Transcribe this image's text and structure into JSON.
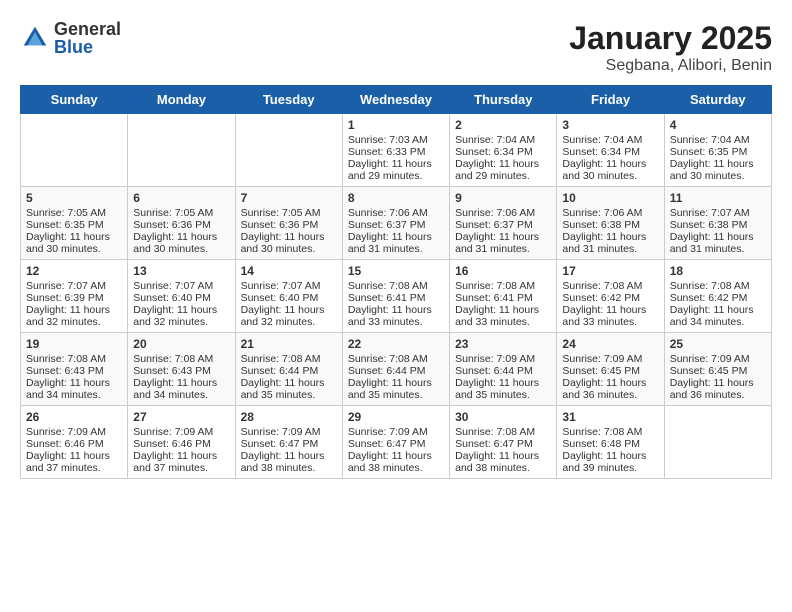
{
  "header": {
    "logo_general": "General",
    "logo_blue": "Blue",
    "title": "January 2025",
    "subtitle": "Segbana, Alibori, Benin"
  },
  "days_of_week": [
    "Sunday",
    "Monday",
    "Tuesday",
    "Wednesday",
    "Thursday",
    "Friday",
    "Saturday"
  ],
  "weeks": [
    [
      {
        "day": "",
        "sunrise": "",
        "sunset": "",
        "daylight": ""
      },
      {
        "day": "",
        "sunrise": "",
        "sunset": "",
        "daylight": ""
      },
      {
        "day": "",
        "sunrise": "",
        "sunset": "",
        "daylight": ""
      },
      {
        "day": "1",
        "sunrise": "Sunrise: 7:03 AM",
        "sunset": "Sunset: 6:33 PM",
        "daylight": "Daylight: 11 hours and 29 minutes."
      },
      {
        "day": "2",
        "sunrise": "Sunrise: 7:04 AM",
        "sunset": "Sunset: 6:34 PM",
        "daylight": "Daylight: 11 hours and 29 minutes."
      },
      {
        "day": "3",
        "sunrise": "Sunrise: 7:04 AM",
        "sunset": "Sunset: 6:34 PM",
        "daylight": "Daylight: 11 hours and 30 minutes."
      },
      {
        "day": "4",
        "sunrise": "Sunrise: 7:04 AM",
        "sunset": "Sunset: 6:35 PM",
        "daylight": "Daylight: 11 hours and 30 minutes."
      }
    ],
    [
      {
        "day": "5",
        "sunrise": "Sunrise: 7:05 AM",
        "sunset": "Sunset: 6:35 PM",
        "daylight": "Daylight: 11 hours and 30 minutes."
      },
      {
        "day": "6",
        "sunrise": "Sunrise: 7:05 AM",
        "sunset": "Sunset: 6:36 PM",
        "daylight": "Daylight: 11 hours and 30 minutes."
      },
      {
        "day": "7",
        "sunrise": "Sunrise: 7:05 AM",
        "sunset": "Sunset: 6:36 PM",
        "daylight": "Daylight: 11 hours and 30 minutes."
      },
      {
        "day": "8",
        "sunrise": "Sunrise: 7:06 AM",
        "sunset": "Sunset: 6:37 PM",
        "daylight": "Daylight: 11 hours and 31 minutes."
      },
      {
        "day": "9",
        "sunrise": "Sunrise: 7:06 AM",
        "sunset": "Sunset: 6:37 PM",
        "daylight": "Daylight: 11 hours and 31 minutes."
      },
      {
        "day": "10",
        "sunrise": "Sunrise: 7:06 AM",
        "sunset": "Sunset: 6:38 PM",
        "daylight": "Daylight: 11 hours and 31 minutes."
      },
      {
        "day": "11",
        "sunrise": "Sunrise: 7:07 AM",
        "sunset": "Sunset: 6:38 PM",
        "daylight": "Daylight: 11 hours and 31 minutes."
      }
    ],
    [
      {
        "day": "12",
        "sunrise": "Sunrise: 7:07 AM",
        "sunset": "Sunset: 6:39 PM",
        "daylight": "Daylight: 11 hours and 32 minutes."
      },
      {
        "day": "13",
        "sunrise": "Sunrise: 7:07 AM",
        "sunset": "Sunset: 6:40 PM",
        "daylight": "Daylight: 11 hours and 32 minutes."
      },
      {
        "day": "14",
        "sunrise": "Sunrise: 7:07 AM",
        "sunset": "Sunset: 6:40 PM",
        "daylight": "Daylight: 11 hours and 32 minutes."
      },
      {
        "day": "15",
        "sunrise": "Sunrise: 7:08 AM",
        "sunset": "Sunset: 6:41 PM",
        "daylight": "Daylight: 11 hours and 33 minutes."
      },
      {
        "day": "16",
        "sunrise": "Sunrise: 7:08 AM",
        "sunset": "Sunset: 6:41 PM",
        "daylight": "Daylight: 11 hours and 33 minutes."
      },
      {
        "day": "17",
        "sunrise": "Sunrise: 7:08 AM",
        "sunset": "Sunset: 6:42 PM",
        "daylight": "Daylight: 11 hours and 33 minutes."
      },
      {
        "day": "18",
        "sunrise": "Sunrise: 7:08 AM",
        "sunset": "Sunset: 6:42 PM",
        "daylight": "Daylight: 11 hours and 34 minutes."
      }
    ],
    [
      {
        "day": "19",
        "sunrise": "Sunrise: 7:08 AM",
        "sunset": "Sunset: 6:43 PM",
        "daylight": "Daylight: 11 hours and 34 minutes."
      },
      {
        "day": "20",
        "sunrise": "Sunrise: 7:08 AM",
        "sunset": "Sunset: 6:43 PM",
        "daylight": "Daylight: 11 hours and 34 minutes."
      },
      {
        "day": "21",
        "sunrise": "Sunrise: 7:08 AM",
        "sunset": "Sunset: 6:44 PM",
        "daylight": "Daylight: 11 hours and 35 minutes."
      },
      {
        "day": "22",
        "sunrise": "Sunrise: 7:08 AM",
        "sunset": "Sunset: 6:44 PM",
        "daylight": "Daylight: 11 hours and 35 minutes."
      },
      {
        "day": "23",
        "sunrise": "Sunrise: 7:09 AM",
        "sunset": "Sunset: 6:44 PM",
        "daylight": "Daylight: 11 hours and 35 minutes."
      },
      {
        "day": "24",
        "sunrise": "Sunrise: 7:09 AM",
        "sunset": "Sunset: 6:45 PM",
        "daylight": "Daylight: 11 hours and 36 minutes."
      },
      {
        "day": "25",
        "sunrise": "Sunrise: 7:09 AM",
        "sunset": "Sunset: 6:45 PM",
        "daylight": "Daylight: 11 hours and 36 minutes."
      }
    ],
    [
      {
        "day": "26",
        "sunrise": "Sunrise: 7:09 AM",
        "sunset": "Sunset: 6:46 PM",
        "daylight": "Daylight: 11 hours and 37 minutes."
      },
      {
        "day": "27",
        "sunrise": "Sunrise: 7:09 AM",
        "sunset": "Sunset: 6:46 PM",
        "daylight": "Daylight: 11 hours and 37 minutes."
      },
      {
        "day": "28",
        "sunrise": "Sunrise: 7:09 AM",
        "sunset": "Sunset: 6:47 PM",
        "daylight": "Daylight: 11 hours and 38 minutes."
      },
      {
        "day": "29",
        "sunrise": "Sunrise: 7:09 AM",
        "sunset": "Sunset: 6:47 PM",
        "daylight": "Daylight: 11 hours and 38 minutes."
      },
      {
        "day": "30",
        "sunrise": "Sunrise: 7:08 AM",
        "sunset": "Sunset: 6:47 PM",
        "daylight": "Daylight: 11 hours and 38 minutes."
      },
      {
        "day": "31",
        "sunrise": "Sunrise: 7:08 AM",
        "sunset": "Sunset: 6:48 PM",
        "daylight": "Daylight: 11 hours and 39 minutes."
      },
      {
        "day": "",
        "sunrise": "",
        "sunset": "",
        "daylight": ""
      }
    ]
  ]
}
